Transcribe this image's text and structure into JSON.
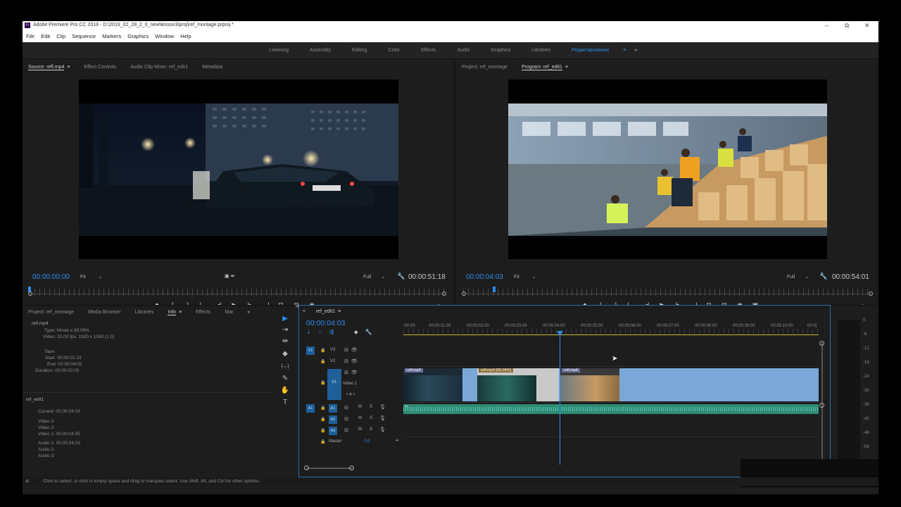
{
  "window": {
    "title": "Adobe Premiere Pro CC 2018 - D:\\2019_02_28_2_0_new\\lesson3\\proj\\ref_montage.prproj *",
    "app_icon": "Pr",
    "controls": {
      "minimize": "–",
      "restore": "⧉",
      "close": "✕"
    }
  },
  "menu": [
    "File",
    "Edit",
    "Clip",
    "Sequence",
    "Markers",
    "Graphics",
    "Window",
    "Help"
  ],
  "workspaces": {
    "items": [
      "Learning",
      "Assembly",
      "Editing",
      "Color",
      "Effects",
      "Audio",
      "Graphics",
      "Libraries",
      "Редактирование"
    ],
    "active": "Редактирование",
    "menu_icon": "≡",
    "overflow": "»"
  },
  "source_panel": {
    "tabs": [
      "Source: refl.mp4",
      "Effect Controls",
      "Audio Clip Mixer: ref_edit1",
      "Metadata"
    ],
    "tab_menu": "≡",
    "timecode": "00:00:00:00",
    "fit": "Fit",
    "quality": "Full",
    "duration": "00:00:51:18"
  },
  "program_panel": {
    "tabs": [
      "Project: ref_montage",
      "Program: ref_edit1"
    ],
    "tab_menu": "≡",
    "timecode": "00:00:04:03",
    "fit": "Fit",
    "quality": "Full",
    "duration": "00:00:54:01"
  },
  "transport": {
    "source": [
      "⬥",
      "{",
      "}",
      "|←",
      "◂|",
      "▶",
      "|▸",
      "→|",
      "⊡",
      "⊟",
      "◉"
    ],
    "program": [
      "⬥",
      "{",
      "}",
      "|←",
      "◂|",
      "▶",
      "|▸",
      "→|",
      "⊡",
      "⊟",
      "◉",
      "▣"
    ],
    "plus": "+"
  },
  "info_panel": {
    "tabs": [
      "Project: ref_montage",
      "Media Browser",
      "Libraries",
      "Info",
      "Effects",
      "Mar"
    ],
    "tab_menu": "≡",
    "overflow": "»",
    "clip_name": "refl.mp4",
    "type": "Type:  Movie x 89.09%",
    "video": "Video:  25,00 fps, 1920 x 1080 (1,0)",
    "tape": "Tape:",
    "start": "Start:  00:00:01:23",
    "end": "End:  00:00:04:02",
    "duration": "Duration:  00:00:02:05",
    "sequence_name": "ref_edit1",
    "current": "Current:  00:00:04:03",
    "video3": "Video 3:",
    "video2": "Video 2:",
    "video1": "Video 1:  00:00:04:05",
    "audio1": "Audio 1:  00;00;04;03",
    "audio2": "Audio 2:",
    "audio3": "Audio 3:"
  },
  "tools": [
    "▶",
    "⇥",
    "⇹",
    "◆",
    "|↔|",
    "✎",
    "✋",
    "T"
  ],
  "timeline": {
    "tab": "ref_edit1",
    "tab_menu": "≡",
    "timecode": "00:00:04:03",
    "ruler": [
      ":00:00",
      "00:00:01:00",
      "00:00:02:00",
      "00:00:03:00",
      "00:00:04:00",
      "00:00:05:00",
      "00:00:06:00",
      "00:00:07:00",
      "00:00:08:00",
      "00:00:09:00",
      "00:00:10:00",
      "00:0("
    ],
    "tracks": {
      "v3": "V3",
      "v2": "V2",
      "v1_src": "V1",
      "v1": "V1",
      "video1_name": "Video 1",
      "a1_src": "A1",
      "a1": "A1",
      "a2": "A2",
      "a3": "A3",
      "master": "Master",
      "master_value": "0,0",
      "m": "M",
      "s": "S"
    },
    "clips": [
      {
        "label": "refl.mp4"
      },
      {
        "label": "refl.mp4 [89,09%]"
      },
      {
        "label": "refl.mp4"
      }
    ],
    "audio_label": "fx",
    "meter_scale": [
      "0",
      "-6",
      "-12",
      "-18",
      "-24",
      "-30",
      "-36",
      "-42",
      "-48",
      "-54"
    ]
  },
  "status_text": "Click to select, or click in empty space and drag to marquee select. Use Shift, Alt, and Ctrl for other options.",
  "colors": {
    "accent": "#2d8ceb",
    "clip_video": "#7aa6d8",
    "clip_audio": "#3aa88a",
    "playhead": "#2d8ceb"
  }
}
